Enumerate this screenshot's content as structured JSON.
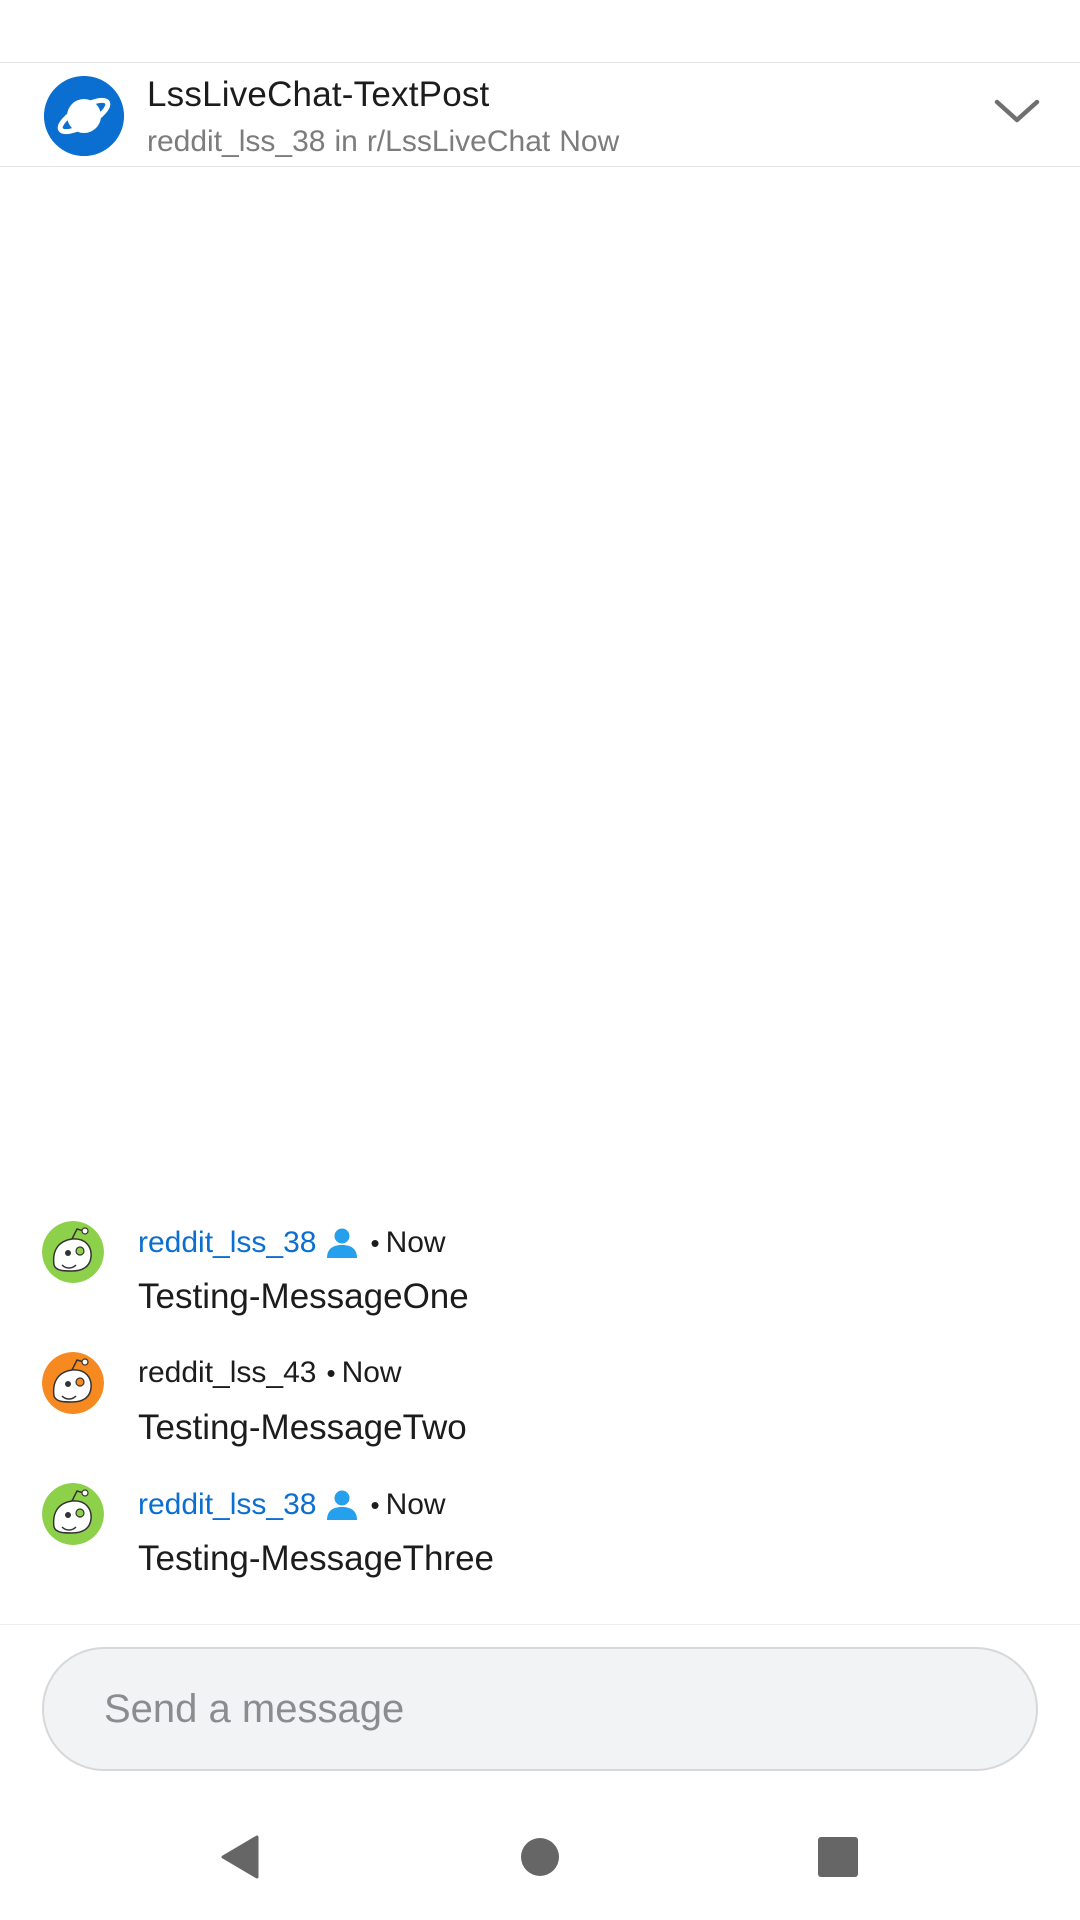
{
  "post": {
    "title": "LssLiveChat-TextPost",
    "author": "reddit_lss_38",
    "in_label": "in",
    "subreddit": "r/LssLiveChat",
    "time": "Now"
  },
  "icons": {
    "subreddit": "planet-icon",
    "collapse": "chevron-down-icon",
    "op_badge": "person-icon"
  },
  "colors": {
    "brand_blue": "#0a6fd1",
    "op_badge_blue": "#24a0ed",
    "avatar_green": "#8dd14a",
    "avatar_orange": "#f6891f"
  },
  "messages": [
    {
      "username": "reddit_lss_38",
      "is_op": true,
      "separator": "•",
      "time": "Now",
      "text": "Testing-MessageOne",
      "avatar_color": "green"
    },
    {
      "username": "reddit_lss_43",
      "is_op": false,
      "separator": "•",
      "time": "Now",
      "text": "Testing-MessageTwo",
      "avatar_color": "orange"
    },
    {
      "username": "reddit_lss_38",
      "is_op": true,
      "separator": "•",
      "time": "Now",
      "text": "Testing-MessageThree",
      "avatar_color": "green"
    }
  ],
  "composer": {
    "placeholder": "Send a message",
    "value": ""
  },
  "system_nav": {
    "back": "back-icon",
    "home": "home-icon",
    "recents": "recents-icon"
  }
}
